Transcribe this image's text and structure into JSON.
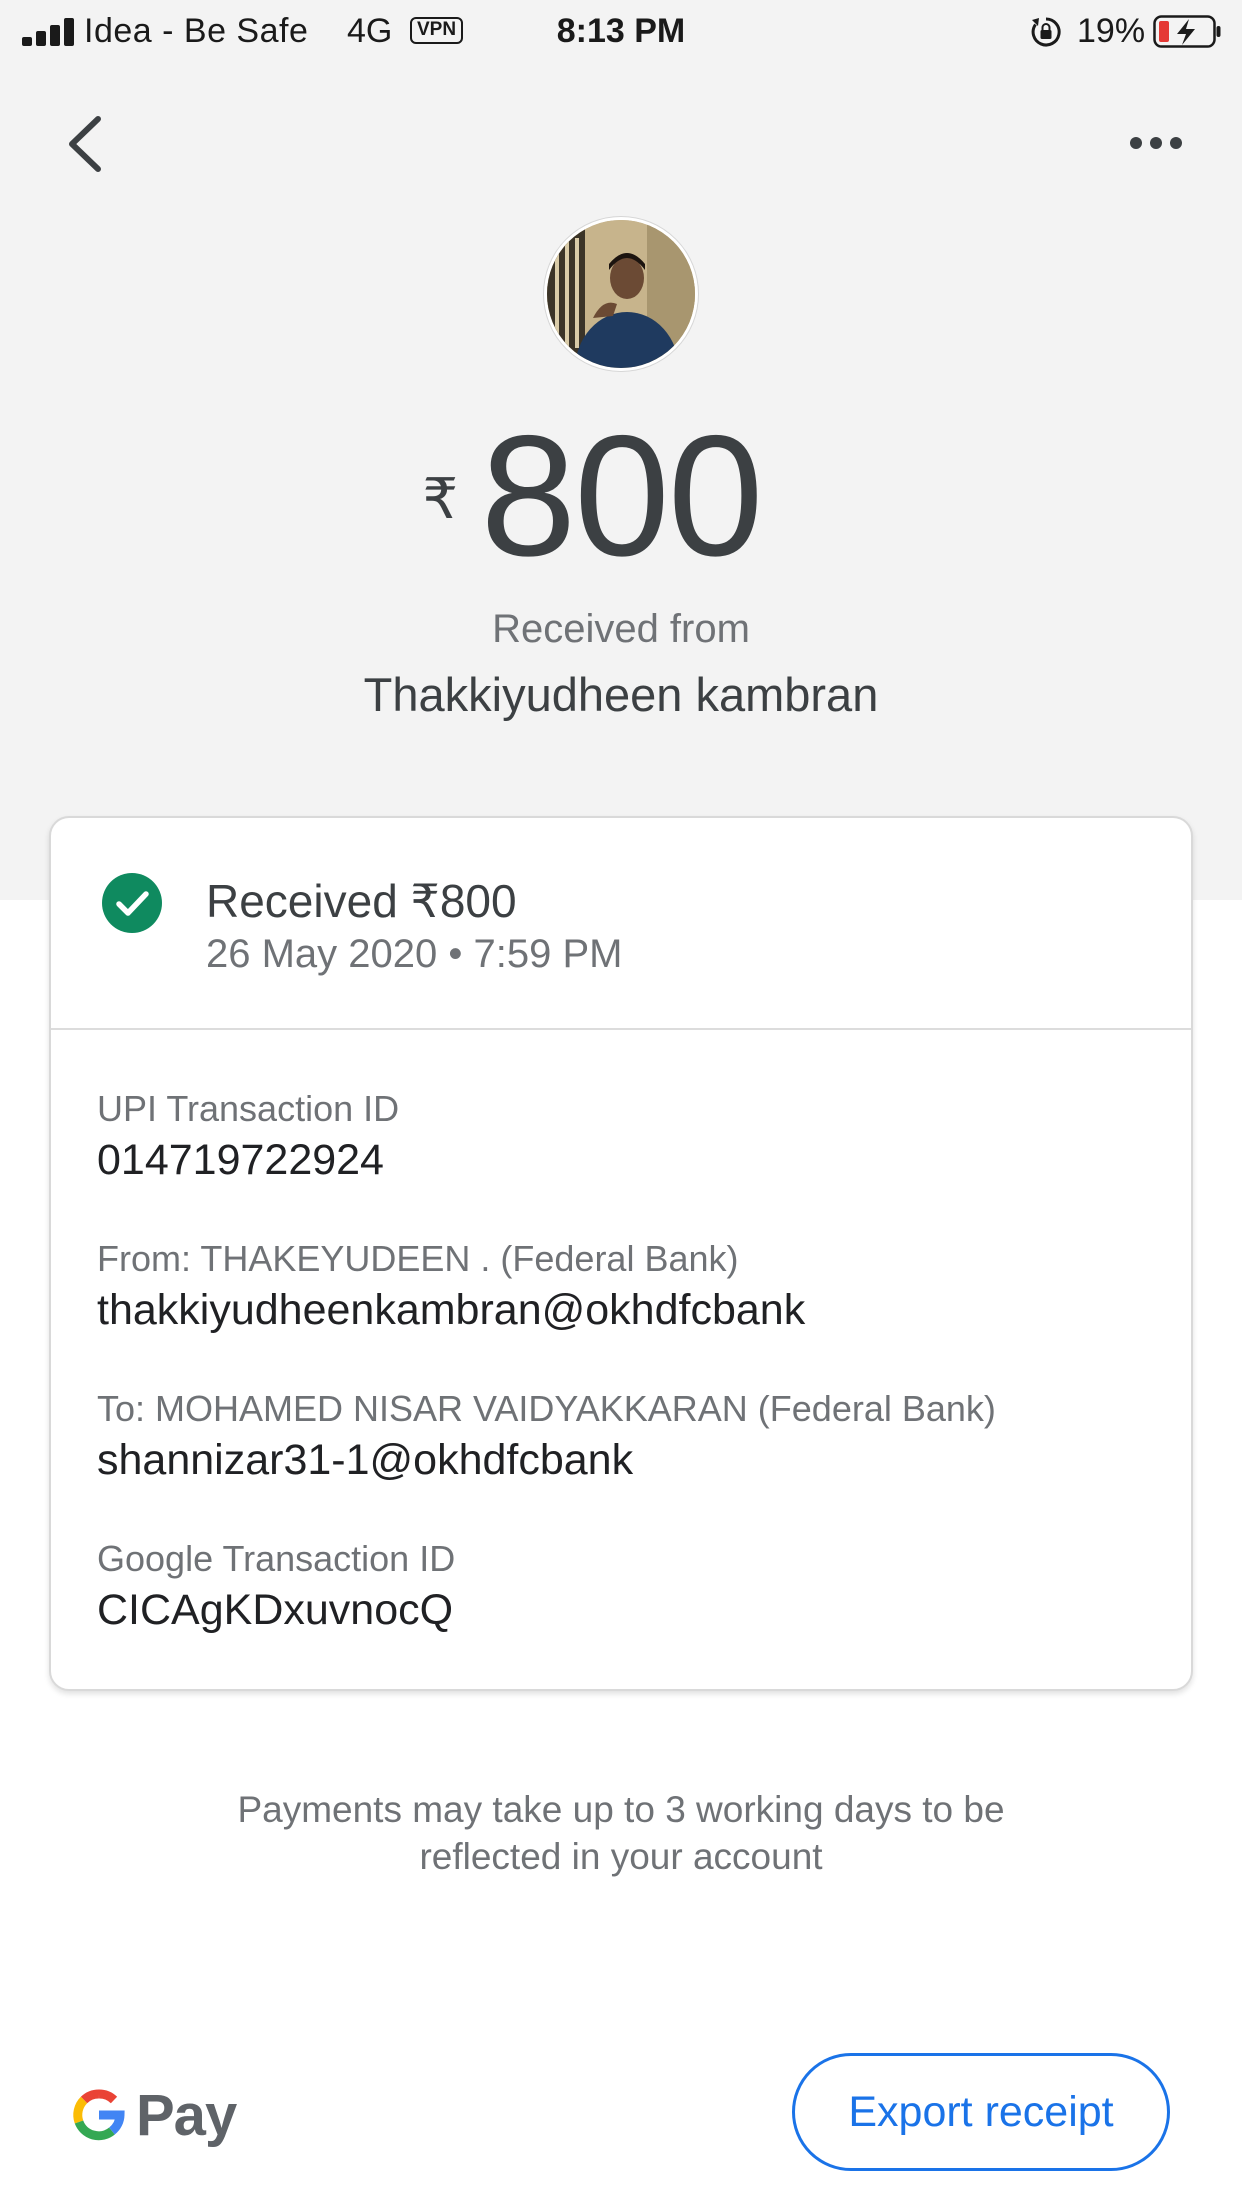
{
  "status_bar": {
    "carrier": "Idea - Be Safe",
    "network": "4G",
    "vpn": "VPN",
    "time": "8:13 PM",
    "battery_percent": "19%"
  },
  "header": {
    "back_icon": "chevron-left-icon",
    "more_icon": "more-horizontal-icon"
  },
  "summary": {
    "currency_symbol": "₹",
    "amount": "800",
    "direction_label": "Received from",
    "counterparty": "Thakkiyudheen kambran"
  },
  "card": {
    "status_title": "Received ₹800",
    "timestamp": "26 May 2020 • 7:59 PM",
    "status_color": "#0f8a5f",
    "details": [
      {
        "label": "UPI Transaction ID",
        "value": "014719722924"
      },
      {
        "label": "From: THAKEYUDEEN . (Federal Bank)",
        "value": "thakkiyudheenkambran@okhdfcbank"
      },
      {
        "label": "To: MOHAMED NISAR VAIDYAKKARAN (Federal Bank)",
        "value": "shannizar31-1@okhdfcbank"
      },
      {
        "label": "Google Transaction ID",
        "value": "CICAgKDxuvnocQ"
      }
    ]
  },
  "note": {
    "line1": "Payments may take up to 3 working days to be",
    "line2": "reflected in your account"
  },
  "footer": {
    "brand": "Pay",
    "export_label": "Export receipt",
    "accent": "#1a73e8"
  }
}
